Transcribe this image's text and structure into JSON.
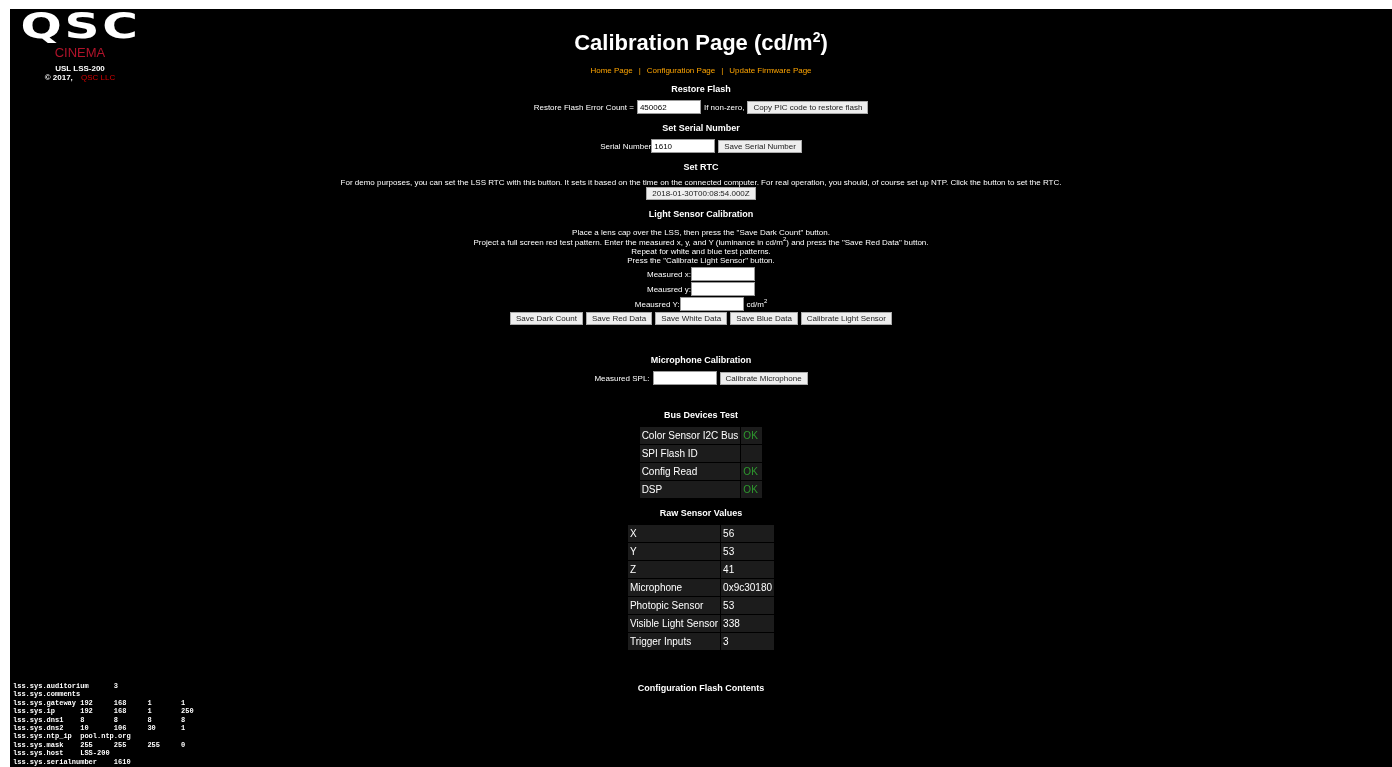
{
  "brand": {
    "logo": "QSC",
    "sub": "CINEMA",
    "model": "USL LSS-200",
    "copyright": "© 2017,",
    "company": "QSC LLC"
  },
  "title": {
    "text": "Calibration Page (cd/m$^{2}$)"
  },
  "nav": [
    {
      "label": "Home Page"
    },
    {
      "label": "Configuration Page"
    },
    {
      "label": "Update Firmware Page"
    }
  ],
  "nav_separator": "|",
  "restore_flash": {
    "heading": "Restore Flash",
    "label": "Restore Flash Error Count =",
    "value": "450062",
    "note": "If non-zero,",
    "button": "Copy PIC code to restore flash"
  },
  "serial": {
    "heading": "Set Serial Number",
    "label": "Serial Number",
    "value": "1610",
    "button": "Save Serial Number"
  },
  "rtc": {
    "heading": "Set RTC",
    "text": "For demo purposes, you can set the LSS RTC with this button. It sets it based on the time on the connected computer. For real operation, you should, of course set up NTP. Click the button to set the RTC.",
    "button": "2018-01-30T00:08:54.000Z"
  },
  "light_sensor": {
    "heading": "Light Sensor Calibration",
    "instructions": [
      "Place a lens cap over the LSS, then press the \"Save Dark Count\" button.",
      "Project a full screen red test pattern. Enter the measured x, y, and Y (luminance in cd/m$^{2}$) and press the \"Save Red Data\" button.",
      "Repeat for white and blue test patterns.",
      "Press the \"Calibrate Light Sensor\" button."
    ],
    "fields": [
      {
        "label": "Measured x:"
      },
      {
        "label": "Meausred y:"
      },
      {
        "label": "Meausred Y:",
        "unit": "cd/m$^{2}$"
      }
    ],
    "buttons": [
      "Save Dark Count",
      "Save Red Data",
      "Save White Data",
      "Save Blue Data",
      "Calibrate Light Sensor"
    ]
  },
  "microphone": {
    "heading": "Microphone Calibration",
    "label": "Measured SPL:",
    "button": "Calibrate Microphone"
  },
  "bus_test": {
    "heading": "Bus Devices Test",
    "rows": [
      {
        "name": "Color Sensor I2C Bus",
        "status": "OK"
      },
      {
        "name": "SPI Flash ID"
      },
      {
        "name": "Config Read",
        "status": "OK"
      },
      {
        "name": "DSP",
        "status": "OK"
      }
    ]
  },
  "raw_sensor": {
    "heading": "Raw Sensor Values",
    "rows": [
      {
        "name": "X",
        "value": "56"
      },
      {
        "name": "Y",
        "value": "53"
      },
      {
        "name": "Z",
        "value": "41"
      },
      {
        "name": "Microphone",
        "value": "0x9c30180"
      },
      {
        "name": "Photopic Sensor",
        "value": "53"
      },
      {
        "name": "Visible Light Sensor",
        "value": "338"
      },
      {
        "name": "Trigger Inputs",
        "value": "3"
      }
    ]
  },
  "config_flash": {
    "heading": "Configuration Flash Contents",
    "lines": [
      "lss.sys.auditorium\t3",
      "lss.sys.comments",
      "lss.sys.gateway 192\t168\t1\t1",
      "lss.sys.ip\t192\t168\t1\t250",
      "lss.sys.dns1\t8\t8\t8\t8",
      "lss.sys.dns2\t10\t106\t30\t1",
      "lss.sys.ntp_ip\tpool.ntp.org",
      "lss.sys.mask\t255\t255\t255\t0",
      "lss.sys.host\tLSS-200",
      "lss.sys.serialnumber\t1610"
    ]
  }
}
